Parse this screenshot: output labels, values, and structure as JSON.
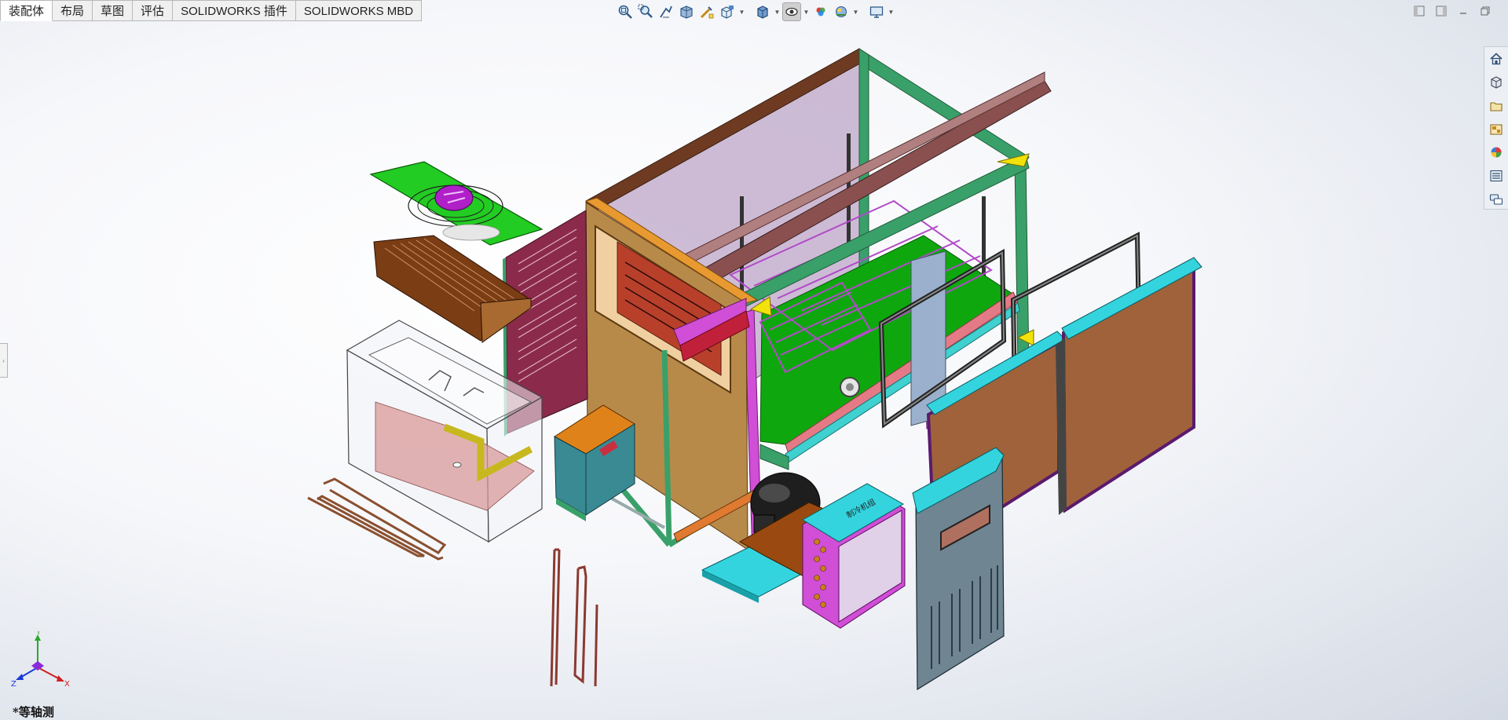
{
  "tabs": [
    {
      "label": "装配体",
      "active": true
    },
    {
      "label": "布局",
      "active": false
    },
    {
      "label": "草图",
      "active": false
    },
    {
      "label": "评估",
      "active": false
    },
    {
      "label": "SOLIDWORKS 插件",
      "active": false
    },
    {
      "label": "SOLIDWORKS MBD",
      "active": false
    }
  ],
  "view_toolbar_icons": [
    "zoom-to-fit-icon",
    "zoom-to-area-icon",
    "previous-view-icon",
    "section-view-icon",
    "dynamic-annotation-views-icon",
    "view-orientation-icon",
    "display-style-icon",
    "hide-show-items-icon",
    "edit-appearance-icon",
    "apply-scene-icon",
    "view-settings-icon"
  ],
  "window_controls": [
    "tile-left-icon",
    "tile-right-icon",
    "minimize-icon",
    "restore-icon"
  ],
  "task_pane_icons": [
    "home-icon",
    "design-library-icon",
    "file-explorer-icon",
    "view-palette-icon",
    "appearances-icon",
    "custom-properties-icon",
    "forum-icon"
  ],
  "component_labels": {
    "condensing_unit_plate": "制冷机组"
  },
  "triad": {
    "y": "Y",
    "x": "X",
    "z": "Z"
  },
  "view_name": "*等轴测",
  "colors": {
    "frame_green": "#3aa06a",
    "base_green": "#0ea80e",
    "door_brown": "#a0623a",
    "door_cap_cyan": "#33d4de",
    "side_panel_orange": "#b88a4a",
    "rail_brown": "#7a4a40",
    "louver_panel": "#8b2a4a",
    "grey_cover": "#6f8591"
  }
}
